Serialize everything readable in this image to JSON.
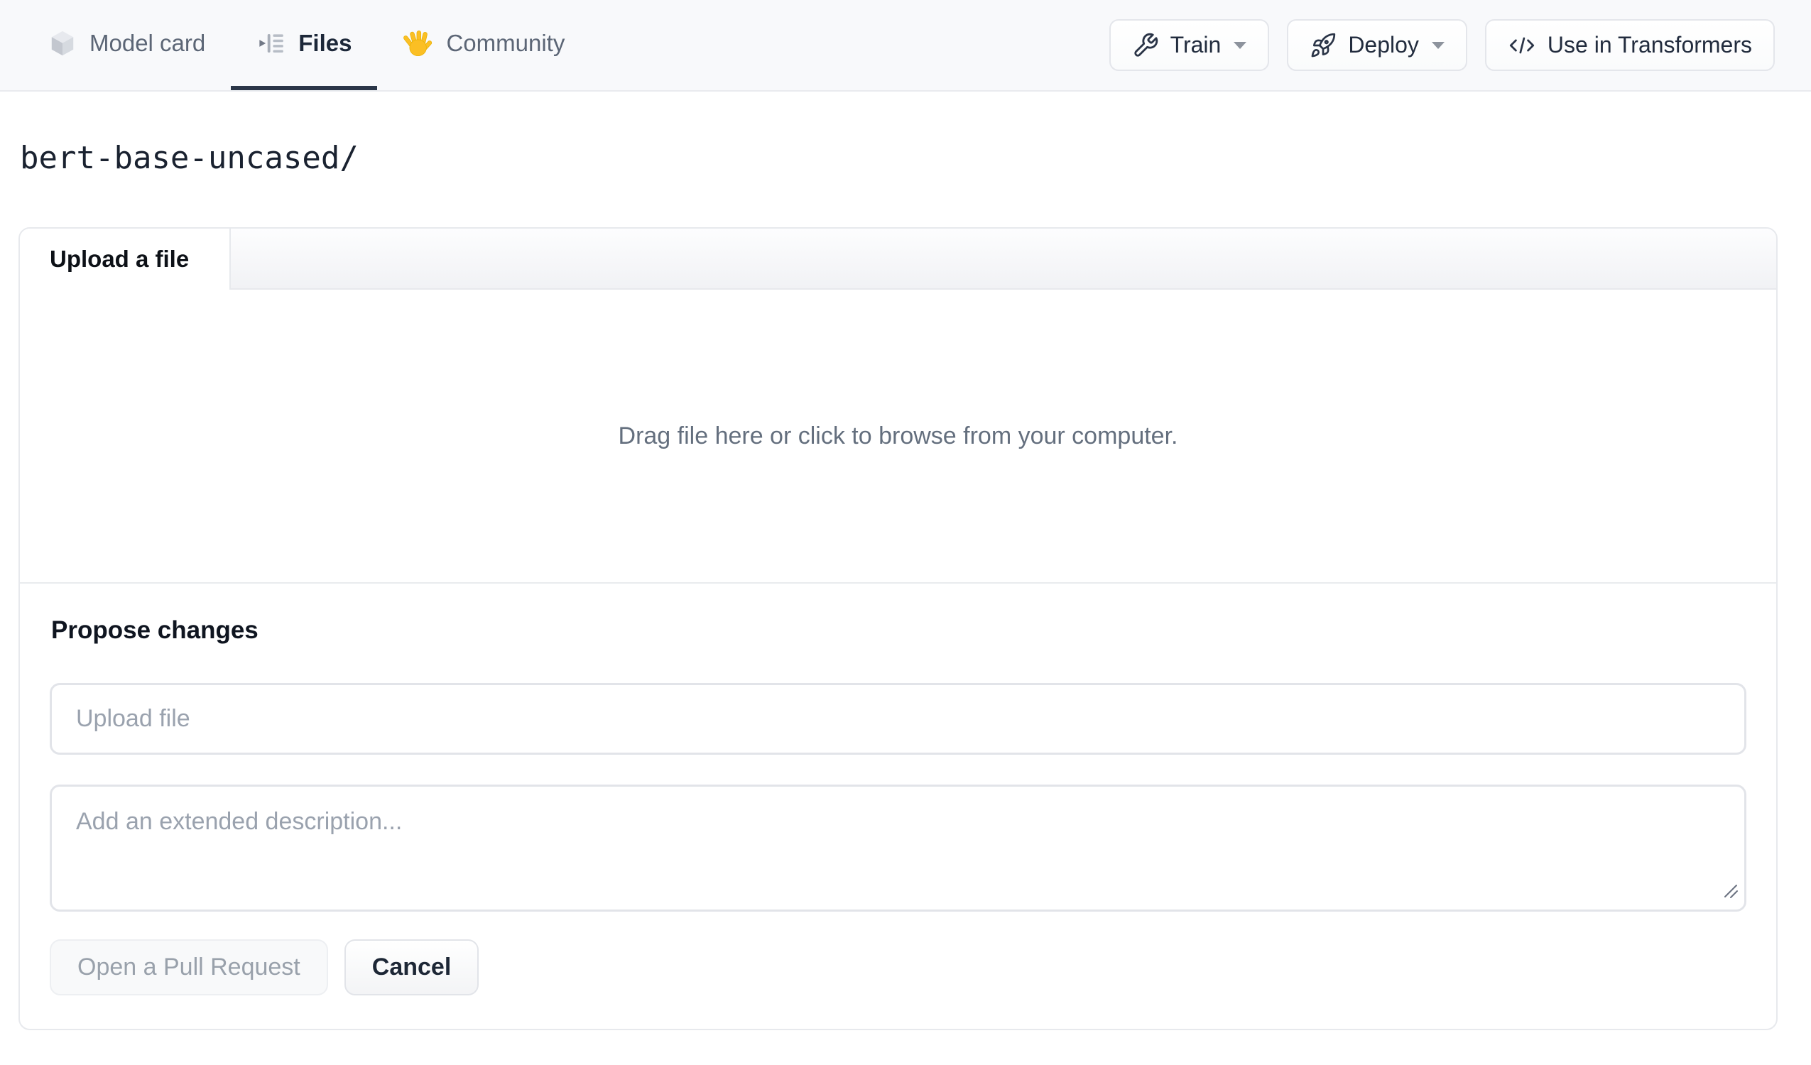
{
  "nav": {
    "tabs": [
      {
        "label": "Model card",
        "icon": "cube-icon",
        "active": false
      },
      {
        "label": "Files",
        "icon": "files-list-icon",
        "active": true
      },
      {
        "label": "Community",
        "icon": "waving-hand-icon",
        "active": false
      }
    ],
    "actions": [
      {
        "label": "Train",
        "icon": "wrench-icon",
        "has_dropdown": true
      },
      {
        "label": "Deploy",
        "icon": "rocket-icon",
        "has_dropdown": true
      },
      {
        "label": "Use in Transformers",
        "icon": "code-icon",
        "has_dropdown": false
      }
    ]
  },
  "breadcrumb": {
    "path": "bert-base-uncased/"
  },
  "upload_panel": {
    "tab_label": "Upload a file",
    "dropzone_text": "Drag file here or click to browse from your computer.",
    "propose": {
      "heading": "Propose changes",
      "file_input_placeholder": "Upload file",
      "file_input_value": "",
      "description_placeholder": "Add an extended description...",
      "description_value": "",
      "primary_button": "Open a Pull Request",
      "cancel_button": "Cancel"
    }
  },
  "colors": {
    "nav_background": "#f8f9fb",
    "active_tab_text": "#1d2839",
    "active_tab_underline": "#2b3648",
    "inactive_tab_text": "#5c6676",
    "panel_border": "#e7e9ed",
    "input_border": "#e2e4e9",
    "muted_text": "#646f7e",
    "placeholder_text": "#9aa2ae",
    "disabled_button_text": "#99a1ab",
    "hand_emoji_yellow": "#fbbf24"
  }
}
